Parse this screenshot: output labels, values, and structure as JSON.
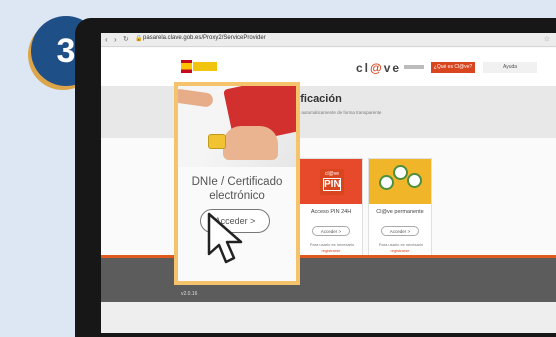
{
  "step_badge": "3",
  "browser": {
    "url": "pasarela.clave.gob.es/Proxy2/ServiceProvider"
  },
  "site": {
    "logo_prefix": "cl",
    "logo_accent": "@",
    "logo_suffix": "ve",
    "que_button": "¿Qué es Cl@ve?",
    "help_button": "Ayuda",
    "heading": "el método de identificación",
    "subheading": "autenticaciones y tenidos a Cl@ve, se le solicitará automáticamente de forma transparente",
    "version": "v2.0.16"
  },
  "cards": [
    {
      "title": "Acceso PIN 24H",
      "button": "Acceder  >",
      "note": "Para usarlo es necesario",
      "link": "registrarse",
      "badge_small": "cl@ve",
      "badge_big": "PIN"
    },
    {
      "title": "Cl@ve permanente",
      "button": "Acceder  >",
      "note": "Para usarlo es necesario",
      "link": "registrarse"
    }
  ],
  "highlight_card": {
    "title": "DNIe / Certificado electrónico",
    "button": "Acceder  >"
  },
  "colors": {
    "accent": "#d9451e",
    "highlight_border": "#f5c36b",
    "badge_bg": "#1f4f87",
    "badge_shadow": "#dda54a"
  }
}
